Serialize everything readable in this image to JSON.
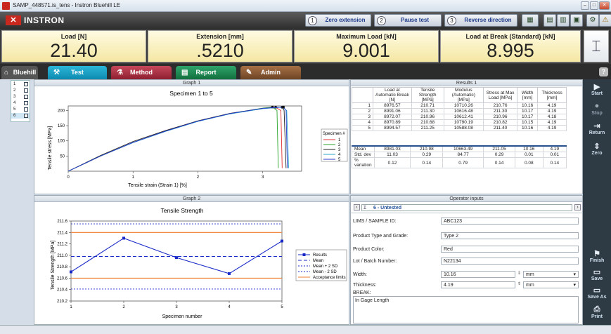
{
  "window": {
    "title": "SAMP_448571.is_tens - Instron Bluehill LE"
  },
  "toolbar": {
    "logo": "INSTRON",
    "zero_num": "1",
    "zero_label": "Zero extension",
    "pause_num": "2",
    "pause_label": "Pause test",
    "reverse_num": "3",
    "reverse_label": "Reverse direction"
  },
  "meters": [
    {
      "label": "Load [N]",
      "value": "21.40"
    },
    {
      "label": "Extension [mm]",
      "value": ".5210"
    },
    {
      "label": "Maximum Load [kN]",
      "value": "9.001"
    },
    {
      "label": "Load at Break (Standard) [kN]",
      "value": "8.995"
    }
  ],
  "tabs": {
    "home": "Bluehill",
    "test": "Test",
    "method": "Method",
    "report": "Report",
    "admin": "Admin",
    "help": "?"
  },
  "specimens": [
    "1",
    "2",
    "3",
    "4",
    "5",
    "6"
  ],
  "graph1": {
    "header": "Graph 1",
    "title": "Specimen 1 to 5",
    "xlabel": "Tensile strain (Strain 1) [%]",
    "ylabel": "Tensile stress [MPa]",
    "legend_title": "Specimen #"
  },
  "graph2": {
    "header": "Graph 2",
    "title": "Tensile Strength",
    "xlabel": "Specimen number",
    "ylabel": "Tensile Strength [MPa]",
    "legend": [
      "Results",
      "Mean",
      "Mean + 2 SD",
      "Mean - 2 SD",
      "Acceptance limits"
    ]
  },
  "chart_data": [
    {
      "type": "line",
      "title": "Specimen 1 to 5",
      "xlabel": "Tensile strain (Strain 1) [%]",
      "ylabel": "Tensile stress [MPa]",
      "xlim": [
        0,
        3.6
      ],
      "ylim": [
        0,
        215
      ],
      "xticks": [
        0,
        1,
        2,
        3
      ],
      "yticks": [
        50,
        100,
        150,
        200
      ],
      "series": [
        {
          "name": "1",
          "color": "#e03030",
          "x": [
            0,
            0.5,
            1,
            1.5,
            2,
            2.5,
            3,
            3.2,
            3.28,
            3.3
          ],
          "y": [
            0,
            50,
            95,
            132,
            165,
            190,
            207,
            210.7,
            200,
            10
          ]
        },
        {
          "name": "2",
          "color": "#28a428",
          "x": [
            0,
            0.5,
            1,
            1.5,
            2,
            2.5,
            3,
            3.15,
            3.22,
            3.24
          ],
          "y": [
            0,
            50,
            95,
            132,
            165,
            190,
            208,
            211.3,
            200,
            10
          ]
        },
        {
          "name": "3",
          "color": "#222222",
          "x": [
            0,
            0.5,
            1,
            1.5,
            2,
            2.5,
            3,
            3.3,
            3.33,
            3.36
          ],
          "y": [
            0,
            52,
            98,
            134,
            166,
            191,
            207,
            211.0,
            200,
            10
          ]
        },
        {
          "name": "4",
          "color": "#2aa6c8",
          "x": [
            0,
            0.5,
            1,
            1.5,
            2,
            2.5,
            3,
            3.3,
            3.37,
            3.4
          ],
          "y": [
            0,
            50,
            94,
            131,
            164,
            189,
            206,
            210.7,
            200,
            10
          ]
        },
        {
          "name": "5",
          "color": "#2a3ad0",
          "x": [
            0,
            0.5,
            1,
            1.5,
            2,
            2.5,
            3,
            3.32,
            3.36,
            3.38
          ],
          "y": [
            0,
            50,
            95,
            132,
            165,
            190,
            207,
            211.3,
            200,
            10
          ]
        }
      ]
    },
    {
      "type": "line",
      "title": "Tensile Strength",
      "xlabel": "Specimen number",
      "ylabel": "Tensile Strength [MPa]",
      "xlim": [
        1,
        5
      ],
      "ylim": [
        210.2,
        211.6
      ],
      "xticks": [
        1,
        2,
        3,
        4,
        5
      ],
      "yticks": [
        210.2,
        210.4,
        210.6,
        210.8,
        211.0,
        211.2,
        211.4,
        211.6
      ],
      "results": {
        "x": [
          1,
          2,
          3,
          4,
          5
        ],
        "y": [
          210.71,
          211.3,
          210.96,
          210.68,
          211.25
        ]
      },
      "mean": 210.98,
      "mean_plus_2sd": 211.55,
      "mean_minus_2sd": 210.41,
      "acceptance_limits": [
        210.6,
        211.4
      ]
    }
  ],
  "results": {
    "header": "Results 1",
    "columns": [
      "",
      "Load at Automatic Break [N]",
      "Tensile Strength [MPa]",
      "Modulus (Automatic) [MPa]",
      "Stress at Max Load [MPa]",
      "Width [mm]",
      "Thickness [mm]"
    ],
    "rows": [
      [
        "1",
        "8976.57",
        "210.71",
        "10710.26",
        "210.76",
        "10.16",
        "4.19"
      ],
      [
        "2",
        "8991.06",
        "211.30",
        "10616.48",
        "211.30",
        "10.17",
        "4.19"
      ],
      [
        "3",
        "8972.07",
        "210.96",
        "10612.41",
        "210.96",
        "10.17",
        "4.18"
      ],
      [
        "4",
        "8970.89",
        "210.68",
        "10790.19",
        "210.82",
        "10.15",
        "4.19"
      ],
      [
        "5",
        "8994.57",
        "211.25",
        "10588.08",
        "211.40",
        "10.16",
        "4.19"
      ]
    ],
    "stats": [
      [
        "Mean",
        "8981.03",
        "210.98",
        "10663.49",
        "211.05",
        "10.16",
        "4.19"
      ],
      [
        "Std. dev",
        "11.03",
        "0.29",
        "84.77",
        "0.29",
        "0.01",
        "0.01"
      ],
      [
        "% variation",
        "0.12",
        "0.14",
        "0.79",
        "0.14",
        "0.08",
        "0.14"
      ]
    ]
  },
  "operator": {
    "header": "Operator inputs",
    "specimen": "6 - Untested",
    "fields": [
      {
        "label": "LIMS / SAMPLE ID:",
        "value": "ABC123"
      },
      {
        "label": "Product Type and Grade:",
        "value": "Type 2"
      },
      {
        "label": "Product Color:",
        "value": "Red"
      },
      {
        "label": "Lot / Batch Number:",
        "value": "N22134"
      },
      {
        "label": "Width:",
        "value": "10.16",
        "unit": "mm"
      },
      {
        "label": "Thickness:",
        "value": "4.19",
        "unit": "mm"
      }
    ],
    "break_label": "BREAK:",
    "break_value": "In Gage Length"
  },
  "right_panel": {
    "start": "Start",
    "stop": "Stop",
    "return": "Return",
    "zero": "Zero",
    "finish": "Finish",
    "save": "Save",
    "save_as": "Save As",
    "print": "Print"
  }
}
